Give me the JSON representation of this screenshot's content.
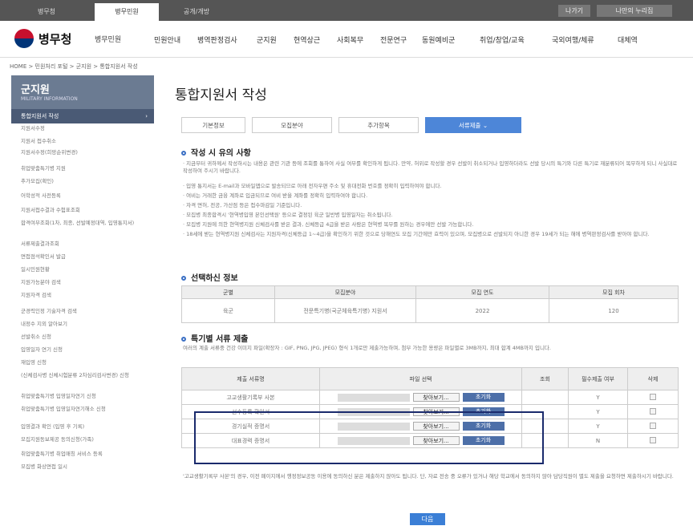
{
  "topbar": {
    "tabs": [
      "병무청",
      "병무민원",
      "공개/개방"
    ],
    "links": [
      "나가기",
      "나만의 누리집"
    ]
  },
  "header": {
    "brand": "병무청",
    "brand_sub": "병무민원",
    "nav": [
      "민원안내",
      "병역판정검사",
      "군지원",
      "현역상근",
      "사회복무",
      "전문연구",
      "동원예비군",
      "취업/창업/교육",
      "국외여행/체류",
      "대체역"
    ]
  },
  "breadcrumb": "HOME > 민원처리 포털 > 군지원 > 통합지원서 작성",
  "sidebar": {
    "title": "군지원",
    "subtitle": "MILITARY INFORMATION",
    "active": "통합지원서 작성",
    "items": [
      "지원서수정",
      "지원서 접수취소",
      "지원서수정(희망순위변경)",
      "취업맞춤특기병 지원",
      "추가모집(확인)",
      "어학성적 사전등록",
      "지원서접수결과 수험표조회",
      "합격여부조회(1차, 최종, 선발예정대역, 입영통지서)",
      "서류제출결과조회",
      "면접점석확인서 발급",
      "일시민원현황",
      "지원가능분야 검색",
      "지원자격 검색",
      "군경력인정 기술자격 검색",
      "내정수 지외 알아보기",
      "선발취소 신청",
      "입영일자 연기 신청",
      "재입영 신청",
      "(신체검사병 신체시험분류 2차심리검사변경) 신청",
      "취업맞춤특기병 입영일자연기 신청",
      "취업맞춤특기병 입영일자연기해소 신청",
      "입영결과 확인 (입영 후 기록)",
      "모집지원동보제공 동의신청(가족)",
      "취업맞춤특기병 취업매칭 서비스 등록",
      "모집병 화상면접 일시"
    ]
  },
  "main": {
    "title": "통합지원서 작성",
    "tabs": [
      "기본정보",
      "모집분야",
      "추가항목",
      "서류제출"
    ],
    "notice": {
      "heading": "작성 시 유의 사항",
      "items": [
        "지금부터 귀하께서 작성하시는 내용은 관련 기관 등에 조회를 통하여 사실 여부를 확인하게 됩니다. 만약, 허위로 작성할 경우 선발이 취소되거나 입영하더라도 선발 당시의 특기와 다른 특기로 재분류되어 복무하게 되니 사실대로 작성하여 주시기 바랍니다.",
        "입영 통지서는 E-mail과 모바일앱으로 발송되므로 아래 전자우편 주소 및 휴대전화 번호를 정확히 입력하여야 합니다.",
        "여비는 거래한 금융 계좌로 입금되므로 여비 받을 계좌를 정확히 입력하여야 합니다.",
        "자격 면허, 전공, 가산점 등은 접수마감일 기준입니다.",
        "모집병 최종합격시 '현역병입영 본인선택원' 등으로 결정된 육군 일반병 입영일자는 취소됩니다.",
        "모집병 지원에 의한 현역병지원 신체검사를 받은 결과, 신체등급 4급을 받은 사람은 현역병 복무를 원하는 경우에만 선발 가능합니다.",
        "18세에 받는 현역병지원 신체검사는 지원자격(신체등급 1~4급)을 확인하기 위한 것으로 당해연도 모집 기간에만 효력이 있으며, 모집병으로 선발되지 아니한 경우 19세가 되는 해에 병역판정검사를 받아야 합니다."
      ]
    },
    "selected": {
      "heading": "선택하신 정보",
      "headers": [
        "군별",
        "모집분야",
        "모집 연도",
        "모집 회차"
      ],
      "row": [
        "육군",
        "전문특기병(국군체육특기병) 지원서",
        "2022",
        "120"
      ]
    },
    "docs": {
      "heading": "특기별 서류 제출",
      "desc": "여러의 계출 서류중 건강 이미지 파일(확장자 : GIF, PNG, JPG, JPEG) 형식 1개로만 제출가능하며, 첨부 가능한 용량은 파일별로 3MB까지, 최대 합계 4MB까지 입니다.",
      "headers": [
        "제출 서류명",
        "파일 선택",
        "조회",
        "필수제출 여부",
        "삭제"
      ],
      "find_label": "찾아보기...",
      "reset_label": "초기화",
      "rows": [
        {
          "name": "고교생활기록부 사본",
          "required": "Y"
        },
        {
          "name": "선수등록 확인서",
          "required": "Y"
        },
        {
          "name": "경기실적 증명서",
          "required": "Y"
        },
        {
          "name": "대표경력 증명서",
          "required": "N"
        }
      ]
    },
    "footnote": "'고교생활기록부 사본'의 경우, 이전 페이지에서 행정정보공동 이용에 동의하신 분은 제출하지 않아도 됩니다. 단, 자료 전송 중 오류가 있거나 해당 학교에서 동의하지 않아 담당직원이 별도 제출을 요청하면 제출하시기 바랍니다.",
    "next_label": "다음"
  }
}
